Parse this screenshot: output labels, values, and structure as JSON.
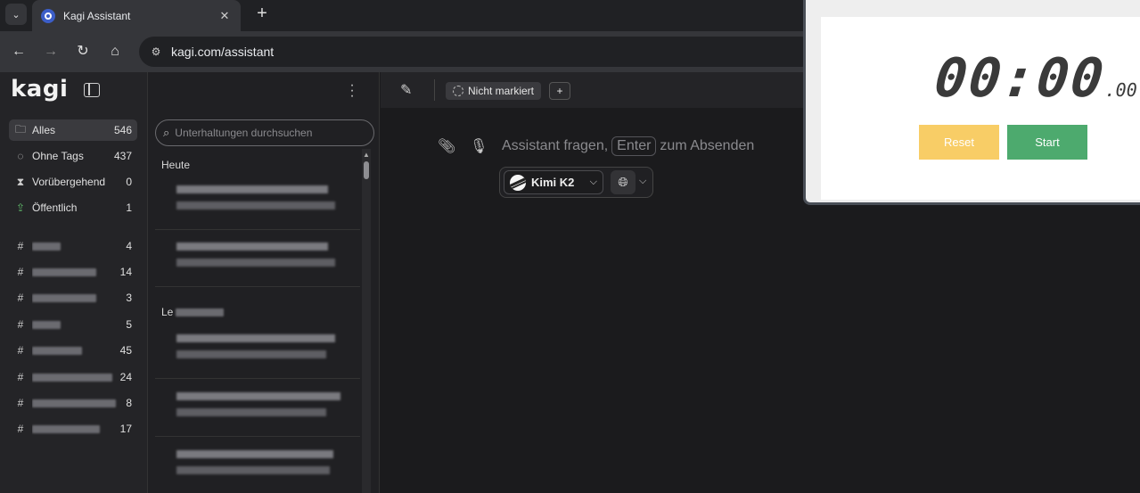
{
  "browser": {
    "tab_title": "Kagi Assistant",
    "tab_close": "✕",
    "new_tab": "+",
    "url": "kagi.com/assistant"
  },
  "sidebar": {
    "logo": "kagi",
    "items": [
      {
        "label": "Alles",
        "count": "546"
      },
      {
        "label": "Ohne Tags",
        "count": "437"
      },
      {
        "label": "Vorübergehend",
        "count": "0"
      },
      {
        "label": "Öffentlich",
        "count": "1"
      }
    ],
    "tags": [
      {
        "count": "4"
      },
      {
        "count": "14"
      },
      {
        "count": "3"
      },
      {
        "count": "5"
      },
      {
        "count": "45"
      },
      {
        "count": "24"
      },
      {
        "count": "8"
      },
      {
        "count": "17"
      }
    ]
  },
  "conversations": {
    "search_placeholder": "Unterhaltungen durchsuchen",
    "group_today": "Heute",
    "group_other_prefix": "Le"
  },
  "main": {
    "tag_chip": "Nicht markiert",
    "add_tag": "+",
    "prompt_before": "Assistant fragen,",
    "prompt_key": "Enter",
    "prompt_after": "zum Absenden",
    "model": "Kimi K2"
  },
  "stopwatch": {
    "time": "00:00",
    "fraction": ".00",
    "reset_label": "Reset",
    "start_label": "Start"
  }
}
